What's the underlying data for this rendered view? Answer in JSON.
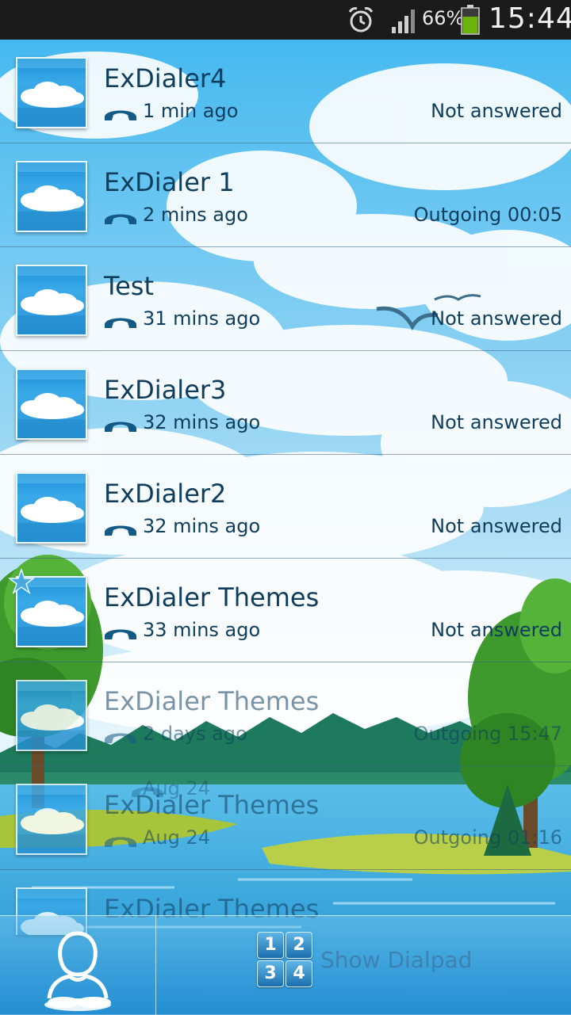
{
  "status_bar": {
    "battery_percent": "66%",
    "time": "15:44",
    "icons": [
      "alarm-clock-icon",
      "signal-strength-icon",
      "battery-icon"
    ],
    "battery_color": "#6bb20a"
  },
  "call_log": [
    {
      "name": "ExDialer4",
      "when": "1 min ago",
      "status": "Not answered",
      "favorite": false
    },
    {
      "name": "ExDialer 1",
      "when": "2 mins ago",
      "status": "Outgoing 00:05",
      "favorite": false
    },
    {
      "name": "Test",
      "when": "31 mins ago",
      "status": "Not answered",
      "favorite": false
    },
    {
      "name": "ExDialer3",
      "when": "32 mins ago",
      "status": "Not answered",
      "favorite": false
    },
    {
      "name": "ExDialer2",
      "when": "32 mins ago",
      "status": "Not answered",
      "favorite": false
    },
    {
      "name": "ExDialer Themes",
      "when": "33 mins ago",
      "status": "Not answered",
      "favorite": true
    },
    {
      "name": "ExDialer Themes",
      "when": "2 days ago",
      "status": "Outgoing 15:47",
      "favorite": false
    },
    {
      "name": "ExDialer Themes",
      "when": "Aug 24",
      "status": "Outgoing 01:16",
      "ghost_when": "Aug 24",
      "favorite": false
    },
    {
      "name": "ExDialer Themes",
      "when": "",
      "status": "",
      "favorite": false
    }
  ],
  "bottom_bar": {
    "contacts_icon": "contact-person-icon",
    "dialpad_keys": [
      "1",
      "2",
      "3",
      "4"
    ],
    "dialpad_label": "Show Dialpad"
  },
  "colors": {
    "text": "#0f3d5c",
    "avatar_blue": "#2a96d8",
    "statusbar_bg": "#1b1b1b"
  }
}
